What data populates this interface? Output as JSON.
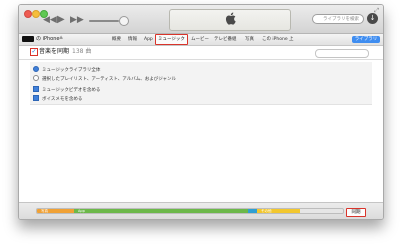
{
  "toolbar": {
    "prev_icon": "rewind-icon",
    "play_icon": "play-icon",
    "next_icon": "fast-forward-icon",
    "apple_glyph": "",
    "search_placeholder": "ライブラリを検索",
    "download_glyph": "↓"
  },
  "device": {
    "name": "の iPhone",
    "eject": "≜"
  },
  "tabs": [
    {
      "label": "概要",
      "active": false
    },
    {
      "label": "情報",
      "active": false
    },
    {
      "label": "App",
      "active": false
    },
    {
      "label": "ミュージック",
      "active": true
    },
    {
      "label": "ムービー",
      "active": false
    },
    {
      "label": "テレビ番組",
      "active": false
    },
    {
      "label": "写真",
      "active": false
    },
    {
      "label": "この iPhone 上",
      "active": false
    }
  ],
  "library_button": "ライブラリ",
  "sync": {
    "title": "音楽を同期",
    "count": "138 曲",
    "checked": true
  },
  "options": {
    "radio_entire": "ミュージックライブラリ全体",
    "radio_selected": "選択したプレイリスト、アーティスト、アルバム、およびジャンル",
    "check_videos": "ミュージックビデオを含める",
    "check_voice_memos": "ボイスメモを含める"
  },
  "capacity": {
    "segments": [
      {
        "label": "写真",
        "color": "#f0a135",
        "fraction": 0.12
      },
      {
        "label": "App",
        "color": "#6cb84a",
        "fraction": 0.57
      },
      {
        "label": "",
        "color": "#2f9fd3",
        "fraction": 0.03
      },
      {
        "label": "その他",
        "color": "#f2c72e",
        "fraction": 0.14
      }
    ]
  },
  "sync_button": "同期",
  "colors": {
    "accent": "#3f8df0",
    "highlight_box": "#d9342b"
  }
}
